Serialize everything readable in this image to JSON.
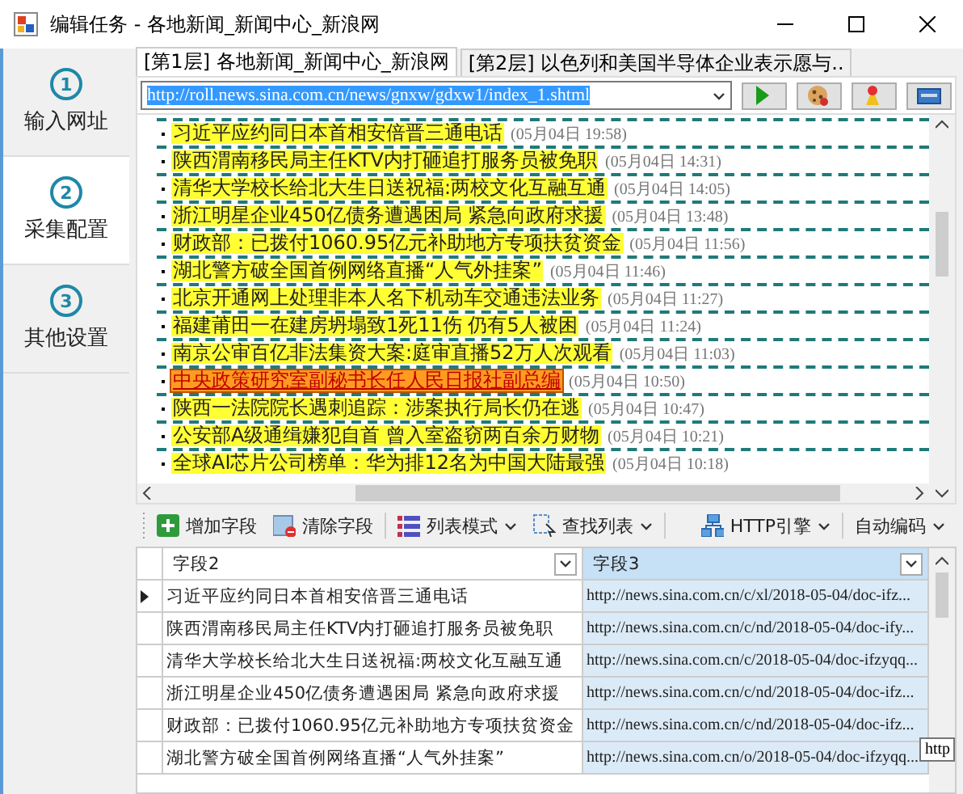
{
  "window": {
    "title": "编辑任务 - 各地新闻_新闻中心_新浪网"
  },
  "steps": [
    {
      "number": "1",
      "label": "输入网址",
      "selected": false
    },
    {
      "number": "2",
      "label": "采集配置",
      "selected": true
    },
    {
      "number": "3",
      "label": "其他设置",
      "selected": false
    }
  ],
  "tabs": [
    {
      "label": "[第1层] 各地新闻_新闻中心_新浪网",
      "selected": true
    },
    {
      "label": "[第2层] 以色列和美国半导体企业表示愿与..",
      "selected": false
    }
  ],
  "url": {
    "value": "http://roll.news.sina.com.cn/news/gnxw/gdxw1/index_1.shtml",
    "selected": true
  },
  "news": [
    {
      "title": "习近平应约同日本首相安倍晋三通电话",
      "time": "(05月04日 19:58)",
      "selected": false
    },
    {
      "title": "陕西渭南移民局主任KTV内打砸追打服务员被免职",
      "time": "(05月04日 14:31)",
      "selected": false
    },
    {
      "title": "清华大学校长给北大生日送祝福:两校文化互融互通",
      "time": "(05月04日 14:05)",
      "selected": false
    },
    {
      "title": "浙江明星企业450亿债务遭遇困局 紧急向政府求援",
      "time": "(05月04日 13:48)",
      "selected": false
    },
    {
      "title": "财政部：已拨付1060.95亿元补助地方专项扶贫资金",
      "time": "(05月04日 11:56)",
      "selected": false
    },
    {
      "title": "湖北警方破全国首例网络直播“人气外挂案”",
      "time": "(05月04日 11:46)",
      "selected": false
    },
    {
      "title": "北京开通网上处理非本人名下机动车交通违法业务",
      "time": "(05月04日 11:27)",
      "selected": false
    },
    {
      "title": "福建莆田一在建房坍塌致1死11伤 仍有5人被困",
      "time": "(05月04日 11:24)",
      "selected": false
    },
    {
      "title": "南京公审百亿非法集资大案:庭审直播52万人次观看",
      "time": "(05月04日 11:03)",
      "selected": false
    },
    {
      "title": "中央政策研究室副秘书长任人民日报社副总编",
      "time": "(05月04日 10:50)",
      "selected": true
    },
    {
      "title": "陕西一法院院长遇刺追踪：涉案执行局长仍在逃",
      "time": "(05月04日 10:47)",
      "selected": false
    },
    {
      "title": "公安部A级通缉嫌犯自首 曾入室盗窃两百余万财物",
      "time": "(05月04日 10:21)",
      "selected": false
    },
    {
      "title": "全球AI芯片公司榜单：华为排12名为中国大陆最强",
      "time": "(05月04日 10:18)",
      "selected": false
    }
  ],
  "toolbar": {
    "left": [
      {
        "label": "增加字段",
        "kind": "button"
      },
      {
        "label": "清除字段",
        "kind": "button"
      },
      {
        "label": "列表模式",
        "kind": "dropdown"
      },
      {
        "label": "查找列表",
        "kind": "dropdown"
      }
    ],
    "right": [
      {
        "label": "HTTP引擎",
        "kind": "dropdown"
      },
      {
        "label": "自动编码",
        "kind": "dropdown"
      }
    ]
  },
  "grid": {
    "columns": [
      {
        "label": "字段2",
        "selected": false
      },
      {
        "label": "字段3",
        "selected": true
      }
    ],
    "rows": [
      {
        "selected": true,
        "cells": [
          "习近平应约同日本首相安倍晋三通电话",
          "http://news.sina.com.cn/c/xl/2018-05-04/doc-ifz..."
        ]
      },
      {
        "selected": false,
        "cells": [
          "陕西渭南移民局主任KTV内打砸追打服务员被免职",
          "http://news.sina.com.cn/c/nd/2018-05-04/doc-ify..."
        ]
      },
      {
        "selected": false,
        "cells": [
          "清华大学校长给北大生日送祝福:两校文化互融互通",
          "http://news.sina.com.cn/c/2018-05-04/doc-ifzyqq..."
        ]
      },
      {
        "selected": false,
        "cells": [
          "浙江明星企业450亿债务遭遇困局 紧急向政府求援",
          "http://news.sina.com.cn/c/nd/2018-05-04/doc-ifz..."
        ]
      },
      {
        "selected": false,
        "cells": [
          "财政部：已拨付1060.95亿元补助地方专项扶贫资金",
          "http://news.sina.com.cn/c/nd/2018-05-04/doc-ifz..."
        ]
      },
      {
        "selected": false,
        "cells": [
          "湖北警方破全国首例网络直播“人气外挂案”",
          "http://news.sina.com.cn/o/2018-05-04/doc-ifzyqq..."
        ]
      }
    ]
  },
  "tooltip": "http"
}
